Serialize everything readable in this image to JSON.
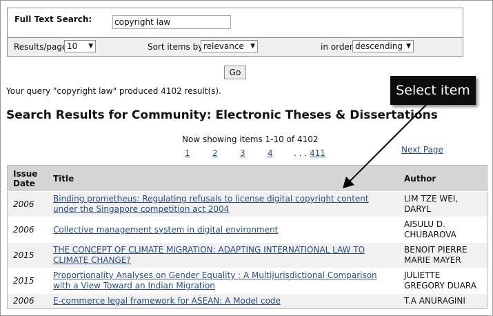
{
  "search": {
    "label": "Full Text Search:",
    "value": "copyright law"
  },
  "options": {
    "results_per_page_label": "Results/page",
    "results_per_page_value": "10",
    "sort_label": "Sort items by",
    "sort_value": "relevance",
    "order_label": "in order",
    "order_value": "descending"
  },
  "go_label": "Go",
  "query_message": "Your query \"copyright law\" produced 4102 result(s).",
  "heading": "Search Results for Community: Electronic Theses & Dissertations",
  "showing": "Now showing items 1-10 of 4102",
  "pages": [
    "1",
    "2",
    "3",
    "4",
    "411"
  ],
  "ellipsis": ". . .",
  "next_page": "Next Page",
  "callout": "Select item",
  "table": {
    "headers": {
      "date": "Issue Date",
      "title": "Title",
      "author": "Author"
    },
    "rows": [
      {
        "date": "2006",
        "title": "Binding prometheus: Regulating refusals to license digital copyright content under the Singapore competition act 2004",
        "author": "LIM TZE WEI, DARYL"
      },
      {
        "date": "2006",
        "title": "Collective management system in digital environment",
        "author": "AISULU D. CHUBAROVA"
      },
      {
        "date": "2015",
        "title": "THE CONCEPT OF CLIMATE MIGRATION: ADAPTING INTERNATIONAL LAW TO CLIMATE CHANGE?",
        "author": "BENOIT PIERRE MARIE MAYER"
      },
      {
        "date": "2015",
        "title": "Proportionality Analyses on Gender Equality : A Multijurisdictional Comparison with a View Toward an Indian Migration",
        "author": "JULIETTE GREGORY DUARA"
      },
      {
        "date": "2006",
        "title": "E-commerce legal framework for ASEAN: A Model code",
        "author": "T.A ANURAGINI"
      }
    ]
  }
}
